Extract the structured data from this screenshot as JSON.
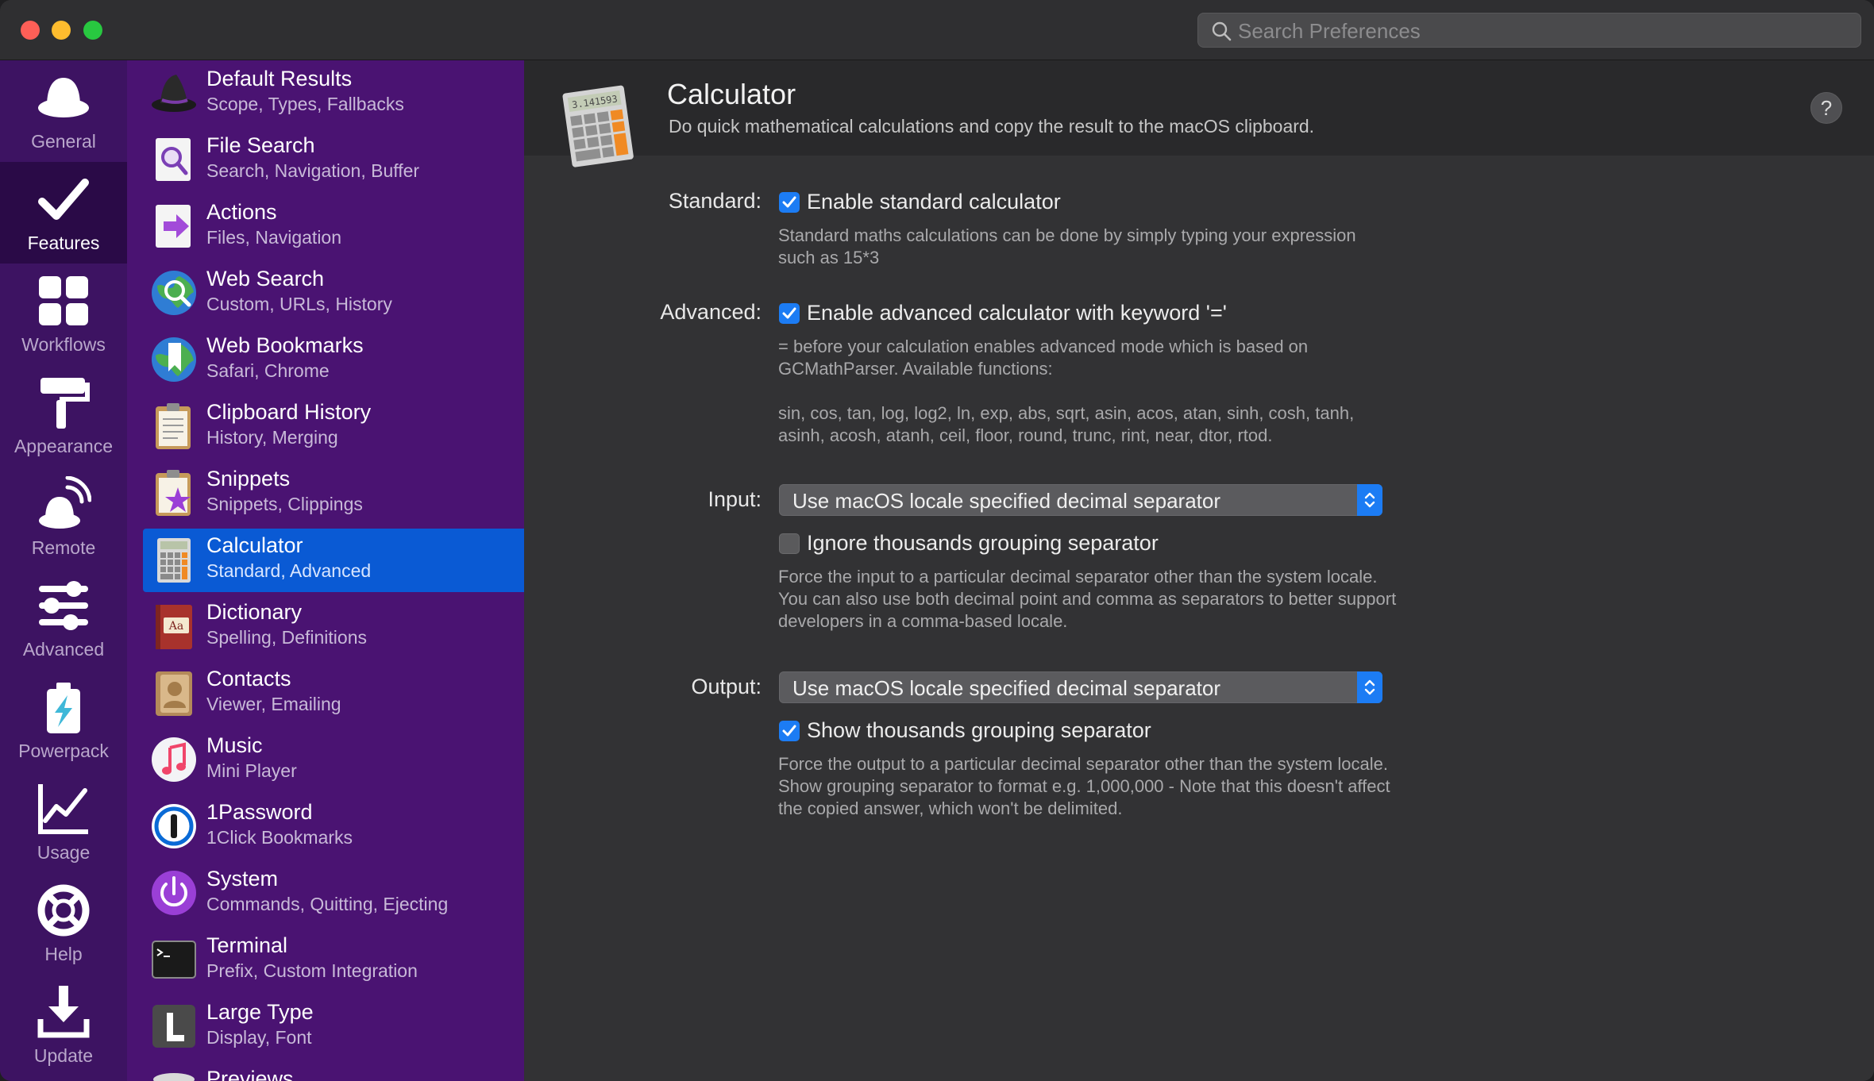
{
  "search": {
    "placeholder": "Search Preferences"
  },
  "rail": {
    "items": [
      {
        "label": "General",
        "icon": "hat-icon"
      },
      {
        "label": "Features",
        "icon": "checkmark-icon"
      },
      {
        "label": "Workflows",
        "icon": "grid-icon"
      },
      {
        "label": "Appearance",
        "icon": "paint-roller-icon"
      },
      {
        "label": "Remote",
        "icon": "remote-icon"
      },
      {
        "label": "Advanced",
        "icon": "sliders-icon"
      },
      {
        "label": "Powerpack",
        "icon": "powerpack-icon"
      },
      {
        "label": "Usage",
        "icon": "chart-icon"
      },
      {
        "label": "Help",
        "icon": "lifebuoy-icon"
      },
      {
        "label": "Update",
        "icon": "download-icon"
      }
    ],
    "active": "Features"
  },
  "features": {
    "items": [
      {
        "title": "Default Results",
        "subtitle": "Scope, Types, Fallbacks"
      },
      {
        "title": "File Search",
        "subtitle": "Search, Navigation, Buffer"
      },
      {
        "title": "Actions",
        "subtitle": "Files, Navigation"
      },
      {
        "title": "Web Search",
        "subtitle": "Custom, URLs, History"
      },
      {
        "title": "Web Bookmarks",
        "subtitle": "Safari, Chrome"
      },
      {
        "title": "Clipboard History",
        "subtitle": "History, Merging"
      },
      {
        "title": "Snippets",
        "subtitle": "Snippets, Clippings"
      },
      {
        "title": "Calculator",
        "subtitle": "Standard, Advanced"
      },
      {
        "title": "Dictionary",
        "subtitle": "Spelling, Definitions"
      },
      {
        "title": "Contacts",
        "subtitle": "Viewer, Emailing"
      },
      {
        "title": "Music",
        "subtitle": "Mini Player"
      },
      {
        "title": "1Password",
        "subtitle": "1Click Bookmarks"
      },
      {
        "title": "System",
        "subtitle": "Commands, Quitting, Ejecting"
      },
      {
        "title": "Terminal",
        "subtitle": "Prefix, Custom Integration"
      },
      {
        "title": "Large Type",
        "subtitle": "Display, Font"
      },
      {
        "title": "Previews",
        "subtitle": ""
      }
    ],
    "selected": "Calculator"
  },
  "panel": {
    "title": "Calculator",
    "description": "Do quick mathematical calculations and copy the result to the macOS clipboard.",
    "help_label": "?",
    "icon_display": "3.141593",
    "standard": {
      "label": "Standard:",
      "checkbox_label": "Enable standard calculator",
      "checked": true,
      "desc_line1": "Standard maths calculations can be done by simply typing your expression",
      "desc_line2": "such as 15*3"
    },
    "advanced": {
      "label": "Advanced:",
      "checkbox_label": "Enable advanced calculator with keyword '='",
      "checked": true,
      "desc_line1": "= before your calculation enables advanced mode which is based on",
      "desc_line2": "GCMathParser. Available functions:",
      "desc_line3": "sin, cos, tan, log, log2, ln, exp, abs, sqrt, asin, acos, atan, sinh, cosh, tanh,",
      "desc_line4": "asinh, acosh, atanh, ceil, floor, round, trunc, rint, near, dtor, rtod."
    },
    "input": {
      "label": "Input:",
      "select_value": "Use macOS locale specified decimal separator",
      "checkbox_label": "Ignore thousands grouping separator",
      "checked": false,
      "desc_line1": "Force the input to a particular decimal separator other than the system locale.",
      "desc_line2": "You can also use both decimal point and comma as separators to better support",
      "desc_line3": "developers in a comma-based locale."
    },
    "output": {
      "label": "Output:",
      "select_value": "Use macOS locale specified decimal separator",
      "checkbox_label": "Show thousands grouping separator",
      "checked": true,
      "desc_line1": "Force the output to a particular decimal separator other than the system locale.",
      "desc_line2": "Show grouping separator to format e.g. 1,000,000 - Note that this doesn't affect",
      "desc_line3": "the copied answer, which won't be delimited."
    }
  },
  "colors": {
    "rail_bg": "#3d1362",
    "list_bg": "#4a1372",
    "selection": "#0a5ad4",
    "accent": "#1c7cf4"
  }
}
